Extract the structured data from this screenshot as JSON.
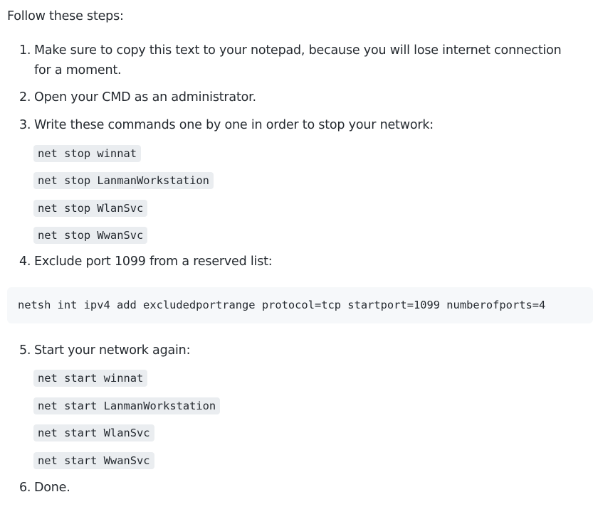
{
  "intro": "Follow these steps:",
  "steps": {
    "s1": {
      "num": "1.",
      "text": "Make sure to copy this text to your notepad, because you will lose internet connection for a moment."
    },
    "s2": {
      "num": "2.",
      "text": "Open your CMD as an administrator."
    },
    "s3": {
      "num": "3.",
      "text": "Write these commands one by one in order to stop your network:"
    },
    "s4": {
      "num": "4.",
      "text": "Exclude port 1099 from a reserved list:"
    },
    "s5": {
      "num": "5.",
      "text": "Start your network again:"
    },
    "s6": {
      "num": "6.",
      "text": "Done."
    }
  },
  "stop_commands": [
    "net stop winnat",
    "net stop LanmanWorkstation",
    "net stop WlanSvc",
    "net stop WwanSvc"
  ],
  "exclude_command": "netsh int ipv4 add excludedportrange protocol=tcp startport=1099 numberofports=4",
  "start_commands": [
    "net start winnat",
    "net start LanmanWorkstation",
    "net start WlanSvc",
    "net start WwanSvc"
  ]
}
